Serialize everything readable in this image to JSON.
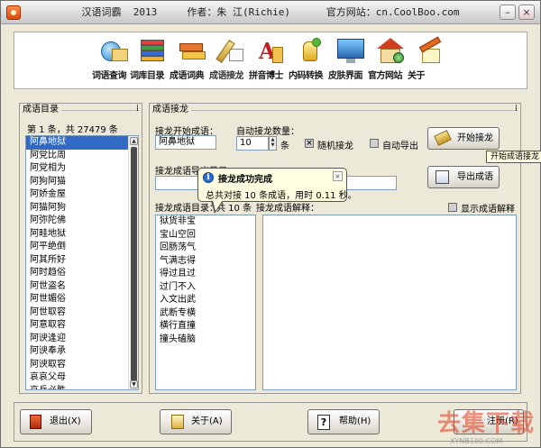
{
  "window": {
    "title": "汉语词霸  2013     作者：朱 江(Richie)      官方网站：cn.CoolBoo.com",
    "minimize": "–",
    "close": "×"
  },
  "toolbar": {
    "items": [
      {
        "label": "词语查询",
        "icon": "search-book-icon"
      },
      {
        "label": "词库目录",
        "icon": "book-stack-icon"
      },
      {
        "label": "成语词典",
        "icon": "dictionary-icon"
      },
      {
        "label": "成语接龙",
        "icon": "pen-paper-icon"
      },
      {
        "label": "拼音博士",
        "icon": "pinyin-icon"
      },
      {
        "label": "内码转换",
        "icon": "convert-icon"
      },
      {
        "label": "皮肤界面",
        "icon": "monitor-icon"
      },
      {
        "label": "官方网站",
        "icon": "house-globe-icon"
      },
      {
        "label": "关于",
        "icon": "about-icon"
      }
    ]
  },
  "left_panel": {
    "title": "成语目录",
    "grip": "⁞",
    "count_text": "第 1 条，共 27479 条",
    "items": [
      "阿鼻地狱",
      "阿党比周",
      "阿党相为",
      "阿狗阿猫",
      "阿娇金屋",
      "阿猫阿狗",
      "阿弥陀佛",
      "阿畦地狱",
      "阿平绝倒",
      "阿其所好",
      "阿时趋俗",
      "阿世盗名",
      "阿世媚俗",
      "阿世取容",
      "阿意取容",
      "阿谀逢迎",
      "阿谀奉承",
      "阿谀取容",
      "哀哀父母",
      "哀兵必胜"
    ],
    "selected_index": 0
  },
  "right_panel": {
    "title": "成语接龙",
    "grip": "⁞",
    "start_label": "接龙开始成语：",
    "start_value": "阿鼻地狱",
    "auto_count_label": "自动接龙数量：",
    "auto_count_value": "10",
    "auto_count_unit": "条",
    "random_label": "随机接龙",
    "random_checked": "×",
    "auto_export_label": "自动导出",
    "start_button": "开始接龙",
    "tooltip": "开始成语接龙",
    "export_label": "接龙成语导出目录：",
    "export_value": "",
    "export_button": "导出成语",
    "list_label": "接龙成语目录：",
    "list_label_extra": "共 10 条",
    "explain_label": "接龙成语解释：",
    "show_explain_label": "显示成语解释",
    "results": [
      "狱货非宝",
      "宝山空回",
      "回肠荡气",
      "气满志得",
      "得过且过",
      "过门不入",
      "入文出武",
      "武断专横",
      "横行直撞",
      "撞头磕脑"
    ]
  },
  "balloon": {
    "title": "接龙成功完成",
    "body": "总共对接 10 条成语，用时 0.11 秒。",
    "close": "×",
    "info": "i"
  },
  "bottom": {
    "exit": "退出(X)",
    "about": "关于(A)",
    "help": "帮助(H)",
    "register": "注册(R)"
  },
  "watermark": {
    "text": "去集下载",
    "sub": "XYNB100.COM"
  },
  "colors": {
    "selection": "#316ac5",
    "window_bg": "#ece9d8",
    "tooltip_bg": "#ffffe1"
  }
}
